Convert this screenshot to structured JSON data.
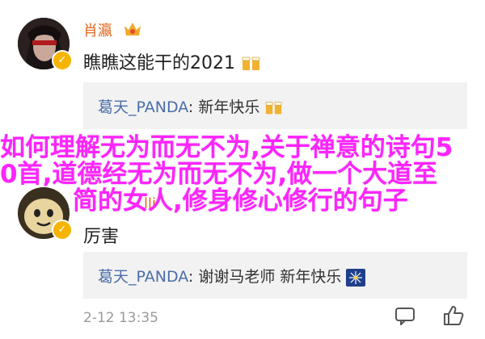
{
  "comments": [
    {
      "username": "肖瀛",
      "avatar_icon": "female-avatar-icon",
      "verified_icon": "verified-v-badge-icon",
      "vip_icon": "vip-crown-badge-icon",
      "text": "瞧瞧这能干的2021",
      "emoji_icon": "beer-cheers-icon",
      "reply": {
        "user": "葛天_PANDA",
        "separator": ": ",
        "text": "新年快乐",
        "emoji_icon": "beer-cheers-icon"
      }
    },
    {
      "username": "lli",
      "avatar_icon": "emoji-face-avatar-icon",
      "verified_icon": "verified-v-badge-icon",
      "text": "厉害",
      "reply": {
        "user": "葛天_PANDA",
        "separator": ": ",
        "text": "谢谢马老师 新年快乐",
        "emoji_icon": "firework-sparkle-icon"
      },
      "timestamp": "2-12 13:35"
    }
  ],
  "overlay": {
    "line1": "如何理解无为而无不为,关于禅意的诗句5",
    "line2": "0首,道德经无为而无不为,做一个大道至",
    "line3": "简的女人,修身修心修行的句子"
  },
  "actions": {
    "comment_icon": "comment-bubble-icon",
    "like_icon": "thumbs-up-icon"
  },
  "colors": {
    "username": "#e2661f",
    "reply_user": "#4a6ea8",
    "overlay": "#ff24ff",
    "reply_bg": "#f2f2f2"
  }
}
